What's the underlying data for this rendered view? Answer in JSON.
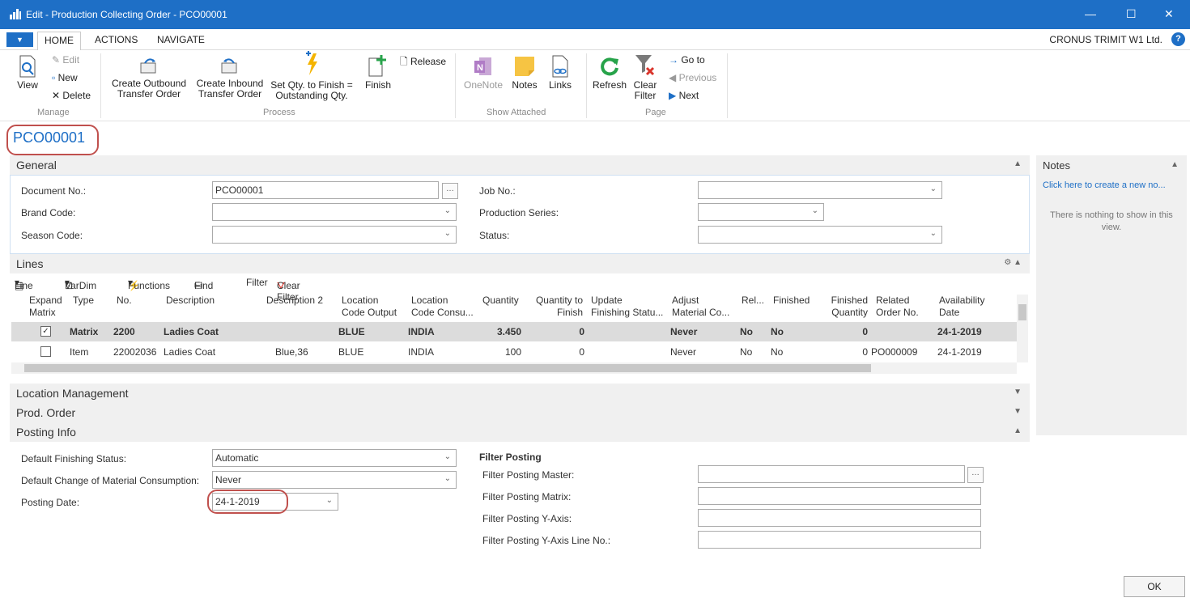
{
  "window": {
    "title": "Edit - Production Collecting Order - PCO00001",
    "minimize": "—",
    "maximize": "☐",
    "close": "✕"
  },
  "ribbon_tabs": {
    "home": "HOME",
    "actions": "ACTIONS",
    "navigate": "NAVIGATE",
    "company": "CRONUS TRIMIT W1 Ltd.",
    "help": "?"
  },
  "ribbon": {
    "view": "View",
    "edit": "Edit",
    "new": "New",
    "delete": "Delete",
    "group_manage": "Manage",
    "create_outbound": [
      "Create Outbound",
      "Transfer Order"
    ],
    "create_inbound": [
      "Create Inbound",
      "Transfer Order"
    ],
    "set_qty": [
      "Set Qty. to Finish =",
      "Outstanding Qty."
    ],
    "finish": "Finish",
    "release": "Release",
    "group_process": "Process",
    "onenote": "OneNote",
    "notes": "Notes",
    "links": "Links",
    "group_show_attached": "Show Attached",
    "refresh": "Refresh",
    "clear_filter": [
      "Clear",
      "Filter"
    ],
    "goto": "Go to",
    "previous": "Previous",
    "next": "Next",
    "group_page": "Page"
  },
  "doc_title": "PCO00001",
  "general": {
    "header": "General",
    "document_no_label": "Document No.:",
    "document_no": "PCO00001",
    "brand_code_label": "Brand Code:",
    "brand_code": "",
    "season_code_label": "Season Code:",
    "season_code": "",
    "job_no_label": "Job No.:",
    "job_no": "",
    "production_series_label": "Production Series:",
    "production_series": "",
    "status_label": "Status:",
    "status": ""
  },
  "lines": {
    "header": "Lines",
    "toolbar": {
      "line": "Line",
      "vardim": "VarDim",
      "functions": "Functions",
      "find": "Find",
      "filter": "Filter",
      "clear_filter": "Clear Filter"
    },
    "columns": [
      [
        "Expand",
        "Matrix"
      ],
      [
        "Type",
        ""
      ],
      [
        "No.",
        ""
      ],
      [
        "Description",
        ""
      ],
      [
        "Description 2",
        ""
      ],
      [
        "Location",
        "Code Output"
      ],
      [
        "Location",
        "Code Consu..."
      ],
      [
        "Quantity",
        ""
      ],
      [
        "Quantity to",
        "Finish"
      ],
      [
        "Update",
        "Finishing Statu..."
      ],
      [
        "Adjust",
        "Material Co..."
      ],
      [
        "Rel...",
        ""
      ],
      [
        "Finished",
        ""
      ],
      [
        "Finished",
        "Quantity"
      ],
      [
        "Related",
        "Order No."
      ],
      [
        "Availability",
        "Date"
      ]
    ],
    "rows": [
      {
        "expand": "✓",
        "type": "Matrix",
        "no": "2200",
        "description": "Ladies Coat",
        "description2": "",
        "loc_out": "BLUE",
        "loc_cons": "INDIA",
        "quantity": "3.450",
        "qty_to_finish": "0",
        "update": "",
        "adjust": "Never",
        "rel": "No",
        "finished": "No",
        "finished_qty": "0",
        "related": "",
        "avail_date": "24-1-2019"
      },
      {
        "expand": "",
        "type": "Item",
        "no": "22002036",
        "description": "Ladies Coat",
        "description2": "Blue,36",
        "loc_out": "BLUE",
        "loc_cons": "INDIA",
        "quantity": "100",
        "qty_to_finish": "0",
        "update": "",
        "adjust": "Never",
        "rel": "No",
        "finished": "No",
        "finished_qty": "0",
        "related": "PO000009",
        "avail_date": "24-1-2019"
      }
    ]
  },
  "sections": {
    "location_management": "Location Management",
    "prod_order": "Prod. Order",
    "posting_info": "Posting Info"
  },
  "posting": {
    "default_finishing_status_label": "Default Finishing Status:",
    "default_finishing_status": "Automatic",
    "default_change_label": "Default Change of Material Consumption:",
    "default_change": "Never",
    "posting_date_label": "Posting Date:",
    "posting_date": "24-1-2019",
    "filter_posting_header": "Filter Posting",
    "filter_master_label": "Filter Posting Master:",
    "filter_master": "",
    "filter_matrix_label": "Filter Posting Matrix:",
    "filter_matrix": "",
    "filter_y_label": "Filter Posting Y-Axis:",
    "filter_y": "",
    "filter_y_line_label": "Filter Posting Y-Axis Line No.:",
    "filter_y_line": ""
  },
  "notes_pane": {
    "header": "Notes",
    "create_link": "Click here to create a new no...",
    "empty": "There is nothing to show in this view."
  },
  "ok": "OK",
  "colors": {
    "accent": "#1e6fc6",
    "highlight": "#c0504d",
    "selected_row": "#dcdcdc"
  }
}
